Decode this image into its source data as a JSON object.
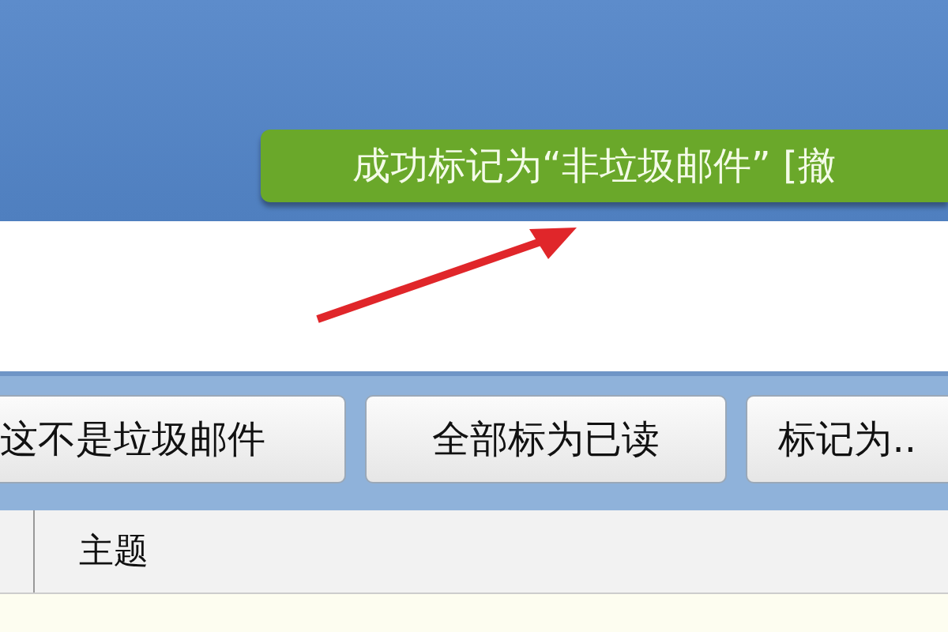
{
  "notification": {
    "text": "成功标记为“非垃圾邮件” [撤"
  },
  "toolbar": {
    "buttons": [
      {
        "label": "这不是垃圾邮件"
      },
      {
        "label": "全部标为已读"
      },
      {
        "label": "标记为.."
      }
    ]
  },
  "table": {
    "columns": [
      {
        "label": "主题"
      }
    ]
  }
}
